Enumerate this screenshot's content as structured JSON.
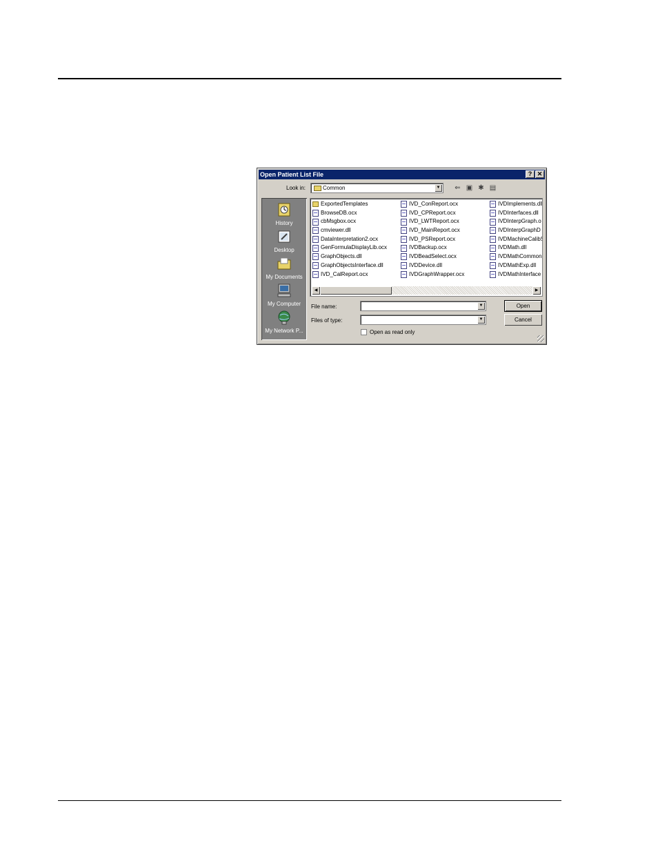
{
  "dialog": {
    "title": "Open Patient List File",
    "title_buttons": [
      "?",
      "✕"
    ],
    "look_in_label": "Look in:",
    "look_in_value": "Common",
    "places": [
      {
        "label": "History",
        "icon": "history-icon"
      },
      {
        "label": "Desktop",
        "icon": "desktop-icon"
      },
      {
        "label": "My Documents",
        "icon": "my-documents-icon"
      },
      {
        "label": "My Computer",
        "icon": "my-computer-icon"
      },
      {
        "label": "My Network P...",
        "icon": "network-places-icon"
      }
    ],
    "files_col1": [
      {
        "name": "ExportedTemplates",
        "type": "folder"
      },
      {
        "name": "BrowseDB.ocx",
        "type": "file"
      },
      {
        "name": "cbMsgbox.ocx",
        "type": "file"
      },
      {
        "name": "cmviewer.dll",
        "type": "file"
      },
      {
        "name": "DataInterpretation2.ocx",
        "type": "file"
      },
      {
        "name": "GenFormulaDisplayLib.ocx",
        "type": "file"
      },
      {
        "name": "GraphObjects.dll",
        "type": "file"
      },
      {
        "name": "GraphObjectsInterface.dll",
        "type": "file"
      },
      {
        "name": "IVD_CalReport.ocx",
        "type": "file"
      }
    ],
    "files_col2": [
      {
        "name": "IVD_ConReport.ocx",
        "type": "file"
      },
      {
        "name": "IVD_CPReport.ocx",
        "type": "file"
      },
      {
        "name": "IVD_LWTReport.ocx",
        "type": "file"
      },
      {
        "name": "IVD_MainReport.ocx",
        "type": "file"
      },
      {
        "name": "IVD_PSReport.ocx",
        "type": "file"
      },
      {
        "name": "IVDBackup.ocx",
        "type": "file"
      },
      {
        "name": "IVDBeadSelect.ocx",
        "type": "file"
      },
      {
        "name": "IVDDevice.dll",
        "type": "file"
      },
      {
        "name": "IVDGraphWrapper.ocx",
        "type": "file"
      }
    ],
    "files_col3": [
      {
        "name": "IVDImplements.dll",
        "type": "file"
      },
      {
        "name": "IVDInterfaces.dll",
        "type": "file"
      },
      {
        "name": "IVDInterpGraph.o",
        "type": "file"
      },
      {
        "name": "IVDInterpGraphD",
        "type": "file"
      },
      {
        "name": "IVDMachineCalibS",
        "type": "file"
      },
      {
        "name": "IVDMath.dll",
        "type": "file"
      },
      {
        "name": "IVDMathCommon",
        "type": "file"
      },
      {
        "name": "IVDMathExp.dll",
        "type": "file"
      },
      {
        "name": "IVDMathInterface",
        "type": "file"
      }
    ],
    "file_name_label": "File name:",
    "file_name_value": "",
    "files_of_type_label": "Files of type:",
    "files_of_type_value": "",
    "open_button": "Open",
    "cancel_button": "Cancel",
    "read_only_label": "Open as read only"
  }
}
